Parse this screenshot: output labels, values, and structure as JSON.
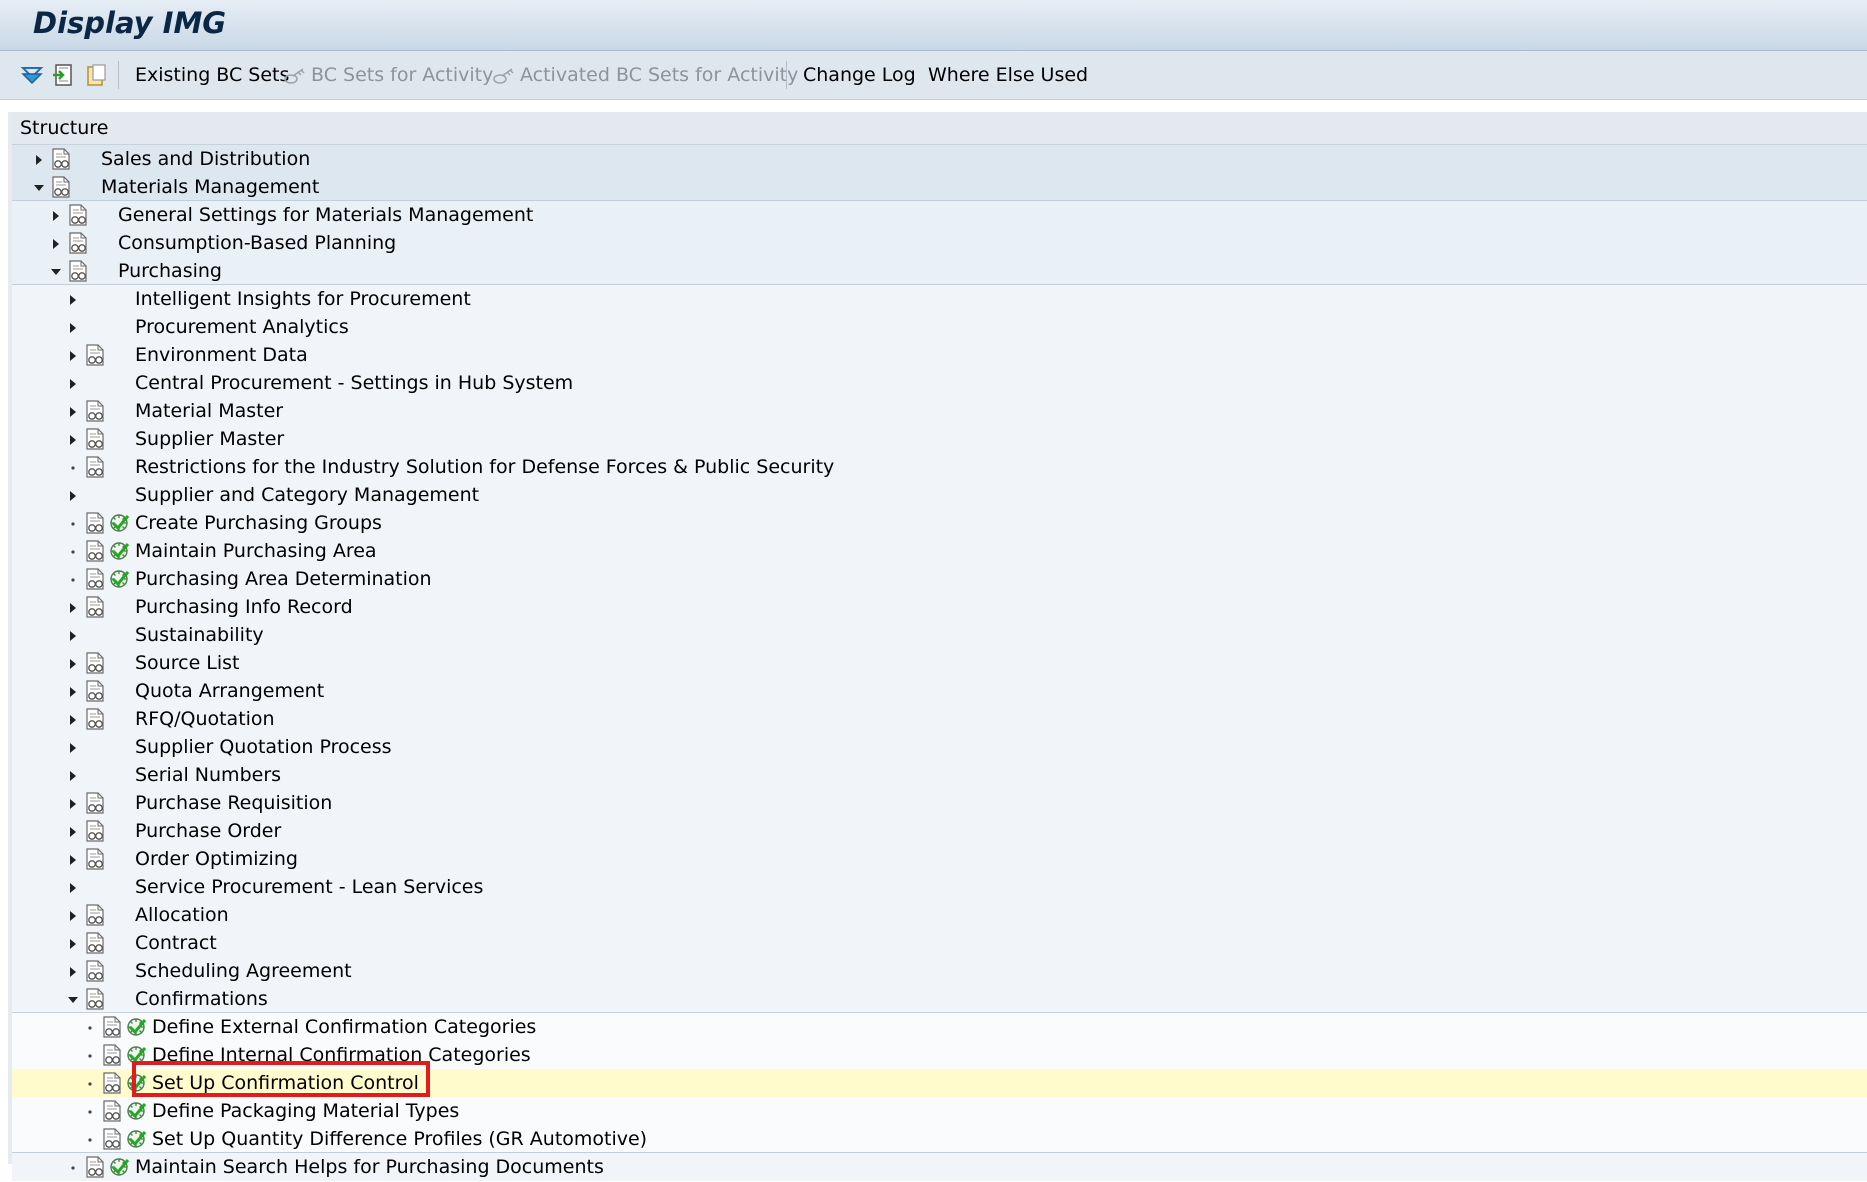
{
  "window": {
    "title": "Display IMG"
  },
  "toolbar": {
    "icons": [
      "expand-tree-icon",
      "import-icon",
      "clipboard-icon"
    ],
    "buttons": [
      {
        "label": "Existing BC Sets",
        "enabled": true
      },
      {
        "label": "BC Sets for Activity",
        "enabled": false,
        "icon": "bc-set-icon"
      },
      {
        "label": "Activated BC Sets for Activity",
        "enabled": false,
        "icon": "bc-set-icon"
      },
      {
        "label": "Change Log",
        "enabled": true
      },
      {
        "label": "Where Else Used",
        "enabled": true
      }
    ]
  },
  "structure": {
    "header": "Structure",
    "rows": [
      {
        "label": "Sales and Distribution",
        "level": 0,
        "toggle": "collapsed",
        "doc": true,
        "exec": false
      },
      {
        "label": "Materials Management",
        "level": 0,
        "toggle": "expanded",
        "doc": true,
        "exec": false
      },
      {
        "label": "General Settings for Materials Management",
        "level": 1,
        "toggle": "collapsed",
        "doc": true,
        "exec": false
      },
      {
        "label": "Consumption-Based Planning",
        "level": 1,
        "toggle": "collapsed",
        "doc": true,
        "exec": false
      },
      {
        "label": "Purchasing",
        "level": 1,
        "toggle": "expanded",
        "doc": true,
        "exec": false
      },
      {
        "label": "Intelligent Insights for Procurement",
        "level": 2,
        "toggle": "collapsed",
        "doc": false,
        "exec": false
      },
      {
        "label": "Procurement Analytics",
        "level": 2,
        "toggle": "collapsed",
        "doc": false,
        "exec": false
      },
      {
        "label": "Environment Data",
        "level": 2,
        "toggle": "collapsed",
        "doc": true,
        "exec": false
      },
      {
        "label": "Central Procurement - Settings in Hub System",
        "level": 2,
        "toggle": "collapsed",
        "doc": false,
        "exec": false
      },
      {
        "label": "Material Master",
        "level": 2,
        "toggle": "collapsed",
        "doc": true,
        "exec": false
      },
      {
        "label": "Supplier Master",
        "level": 2,
        "toggle": "collapsed",
        "doc": true,
        "exec": false
      },
      {
        "label": "Restrictions for the Industry Solution for Defense Forces & Public Security",
        "level": 2,
        "toggle": "leaf",
        "doc": true,
        "exec": false
      },
      {
        "label": "Supplier and Category Management",
        "level": 2,
        "toggle": "collapsed",
        "doc": false,
        "exec": false
      },
      {
        "label": "Create Purchasing Groups",
        "level": 2,
        "toggle": "leaf",
        "doc": true,
        "exec": true
      },
      {
        "label": "Maintain Purchasing Area",
        "level": 2,
        "toggle": "leaf",
        "doc": true,
        "exec": true
      },
      {
        "label": "Purchasing Area Determination",
        "level": 2,
        "toggle": "leaf",
        "doc": true,
        "exec": true
      },
      {
        "label": "Purchasing Info Record",
        "level": 2,
        "toggle": "collapsed",
        "doc": true,
        "exec": false
      },
      {
        "label": "Sustainability",
        "level": 2,
        "toggle": "collapsed",
        "doc": false,
        "exec": false
      },
      {
        "label": "Source List",
        "level": 2,
        "toggle": "collapsed",
        "doc": true,
        "exec": false
      },
      {
        "label": "Quota Arrangement",
        "level": 2,
        "toggle": "collapsed",
        "doc": true,
        "exec": false
      },
      {
        "label": "RFQ/Quotation",
        "level": 2,
        "toggle": "collapsed",
        "doc": true,
        "exec": false
      },
      {
        "label": "Supplier Quotation Process",
        "level": 2,
        "toggle": "collapsed",
        "doc": false,
        "exec": false
      },
      {
        "label": "Serial Numbers",
        "level": 2,
        "toggle": "collapsed",
        "doc": false,
        "exec": false
      },
      {
        "label": "Purchase Requisition",
        "level": 2,
        "toggle": "collapsed",
        "doc": true,
        "exec": false
      },
      {
        "label": "Purchase Order",
        "level": 2,
        "toggle": "collapsed",
        "doc": true,
        "exec": false
      },
      {
        "label": "Order Optimizing",
        "level": 2,
        "toggle": "collapsed",
        "doc": true,
        "exec": false
      },
      {
        "label": "Service Procurement - Lean Services",
        "level": 2,
        "toggle": "collapsed",
        "doc": false,
        "exec": false
      },
      {
        "label": "Allocation",
        "level": 2,
        "toggle": "collapsed",
        "doc": true,
        "exec": false
      },
      {
        "label": "Contract",
        "level": 2,
        "toggle": "collapsed",
        "doc": true,
        "exec": false
      },
      {
        "label": "Scheduling Agreement",
        "level": 2,
        "toggle": "collapsed",
        "doc": true,
        "exec": false
      },
      {
        "label": "Confirmations",
        "level": 2,
        "toggle": "expanded",
        "doc": true,
        "exec": false
      },
      {
        "label": "Define External Confirmation Categories",
        "level": 3,
        "toggle": "leaf",
        "doc": true,
        "exec": true
      },
      {
        "label": "Define Internal Confirmation Categories",
        "level": 3,
        "toggle": "leaf",
        "doc": true,
        "exec": true
      },
      {
        "label": "Set Up Confirmation Control",
        "level": 3,
        "toggle": "leaf",
        "doc": true,
        "exec": true,
        "selected": true
      },
      {
        "label": "Define Packaging Material Types",
        "level": 3,
        "toggle": "leaf",
        "doc": true,
        "exec": true
      },
      {
        "label": "Set Up Quantity Difference Profiles (GR Automotive)",
        "level": 3,
        "toggle": "leaf",
        "doc": true,
        "exec": true
      },
      {
        "label": "Maintain Search Helps for Purchasing Documents",
        "level": 2,
        "toggle": "leaf",
        "doc": true,
        "exec": true
      }
    ]
  },
  "colors": {
    "level0_band": "#dde7f0",
    "level1_band": "#e9f0f6",
    "level2_band": "#f1f5f9",
    "level3_band": "#f9fbfd",
    "selected_row": "#fffbcc",
    "highlight_border": "#e21b1b"
  }
}
